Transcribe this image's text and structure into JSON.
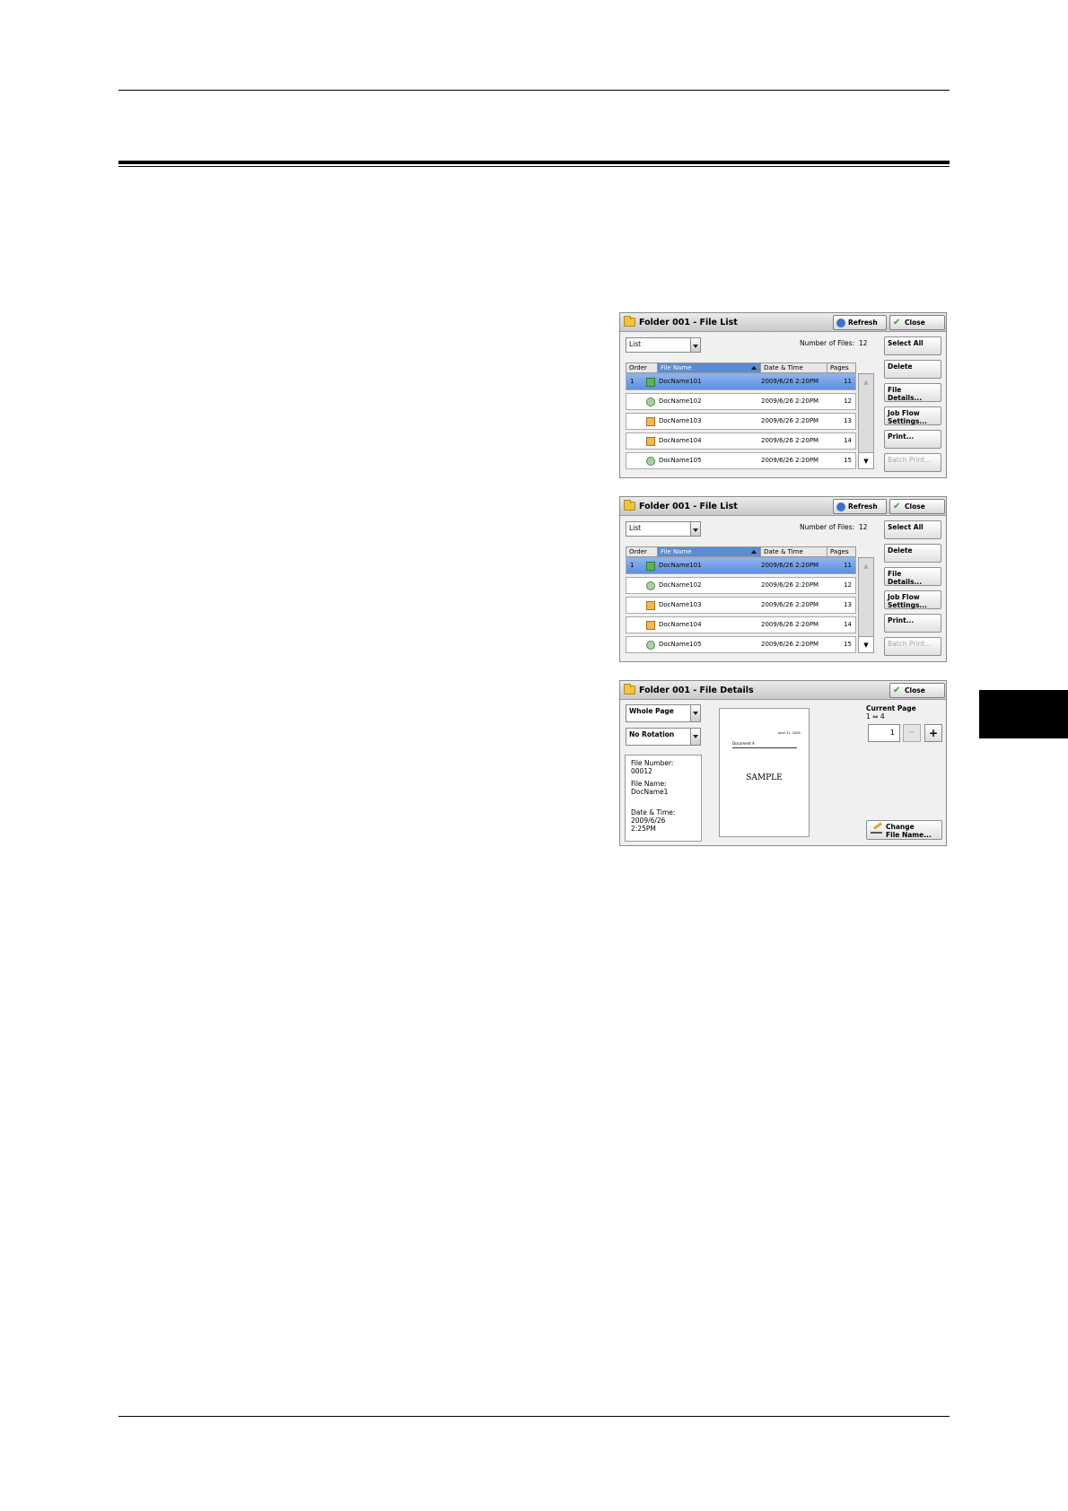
{
  "panels": [
    {
      "title": "Folder 001 - File List",
      "refresh_label": "Refresh",
      "close_label": "Close",
      "view_select": "List",
      "number_of_files_label": "Number of Files:",
      "number_of_files": "12",
      "columns": [
        "Order",
        "File Name",
        "Date & Time",
        "Pages"
      ],
      "rows": [
        {
          "order": "1",
          "name": "DocName101",
          "date": "2009/6/26 2:20PM",
          "pages": "11"
        },
        {
          "order": "",
          "name": "DocName102",
          "date": "2009/6/26 2:20PM",
          "pages": "12"
        },
        {
          "order": "",
          "name": "DocName103",
          "date": "2009/6/26 2:20PM",
          "pages": "13"
        },
        {
          "order": "",
          "name": "DocName104",
          "date": "2009/6/26 2:20PM",
          "pages": "14"
        },
        {
          "order": "",
          "name": "DocName105",
          "date": "2009/6/26 2:20PM",
          "pages": "15"
        }
      ],
      "side_buttons": [
        "Select All",
        "Delete",
        "File Details...",
        "Job Flow\nSettings...",
        "Print...",
        "Batch Print..."
      ]
    },
    {
      "title": "Folder 001 - File List",
      "refresh_label": "Refresh",
      "close_label": "Close",
      "view_select": "List",
      "number_of_files_label": "Number of Files:",
      "number_of_files": "12",
      "columns": [
        "Order",
        "File Name",
        "Date & Time",
        "Pages"
      ],
      "rows": [
        {
          "order": "1",
          "name": "DocName101",
          "date": "2009/6/26 2:20PM",
          "pages": "11"
        },
        {
          "order": "",
          "name": "DocName102",
          "date": "2009/6/26 2:20PM",
          "pages": "12"
        },
        {
          "order": "",
          "name": "DocName103",
          "date": "2009/6/26 2:20PM",
          "pages": "13"
        },
        {
          "order": "",
          "name": "DocName104",
          "date": "2009/6/26 2:20PM",
          "pages": "14"
        },
        {
          "order": "",
          "name": "DocName105",
          "date": "2009/6/26 2:20PM",
          "pages": "15"
        }
      ],
      "side_buttons": [
        "Select All",
        "Delete",
        "File Details...",
        "Job Flow\nSettings...",
        "Print...",
        "Batch Print..."
      ]
    }
  ],
  "details": {
    "title": "Folder 001 - File Details",
    "close_label": "Close",
    "page_select": "Whole Page",
    "rotation_select": "No Rotation",
    "file_number_label": "File Number:",
    "file_number": "00012",
    "file_name_label": "File Name:",
    "file_name": "DocName1",
    "date_label": "Date & Time:",
    "date": "2009/6/26",
    "time": "2:25PM",
    "preview_date": "April 31, 2009",
    "preview_heading": "Document A",
    "preview_text": "SAMPLE",
    "current_page_label": "Current Page",
    "page_range": "1 ⇔ 4",
    "current_page": "1",
    "minus": "−",
    "plus": "+",
    "change_name_label": "Change\nFile Name..."
  }
}
